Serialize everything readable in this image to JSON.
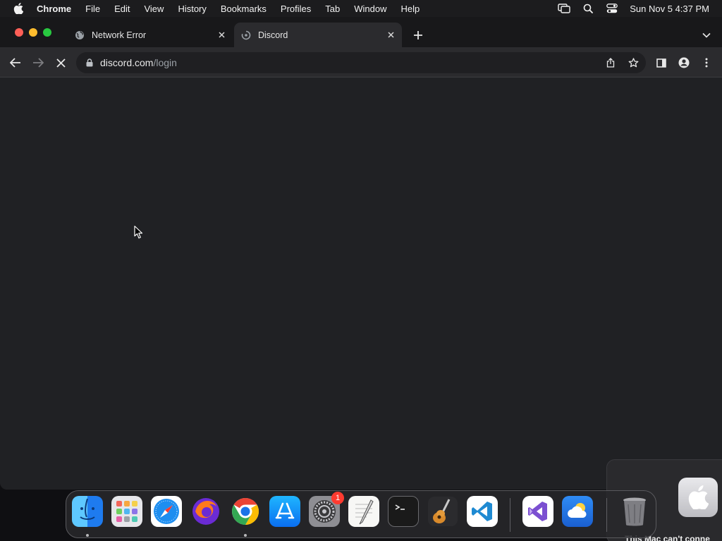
{
  "menubar": {
    "app_name": "Chrome",
    "items": [
      "File",
      "Edit",
      "View",
      "History",
      "Bookmarks",
      "Profiles",
      "Tab",
      "Window",
      "Help"
    ],
    "clock": "Sun Nov 5  4:37 PM"
  },
  "tabs": [
    {
      "title": "Network Error",
      "active": false
    },
    {
      "title": "Discord",
      "active": true
    }
  ],
  "omnibox": {
    "host": "discord.com",
    "path": "/login"
  },
  "notification": {
    "text": "This Mac can't conne"
  },
  "dock": {
    "apps": [
      "Finder",
      "Launchpad",
      "Safari",
      "Firefox",
      "Google Chrome",
      "App Store",
      "System Settings",
      "TextEdit",
      "Terminal",
      "GarageBand",
      "Visual Studio Code",
      "Visual Studio",
      "Weather",
      "Trash"
    ],
    "settings_badge": "1"
  },
  "colors": {
    "page_background": "#202124",
    "toolbar": "#2b2b2e",
    "tabstrip": "#18181a"
  }
}
